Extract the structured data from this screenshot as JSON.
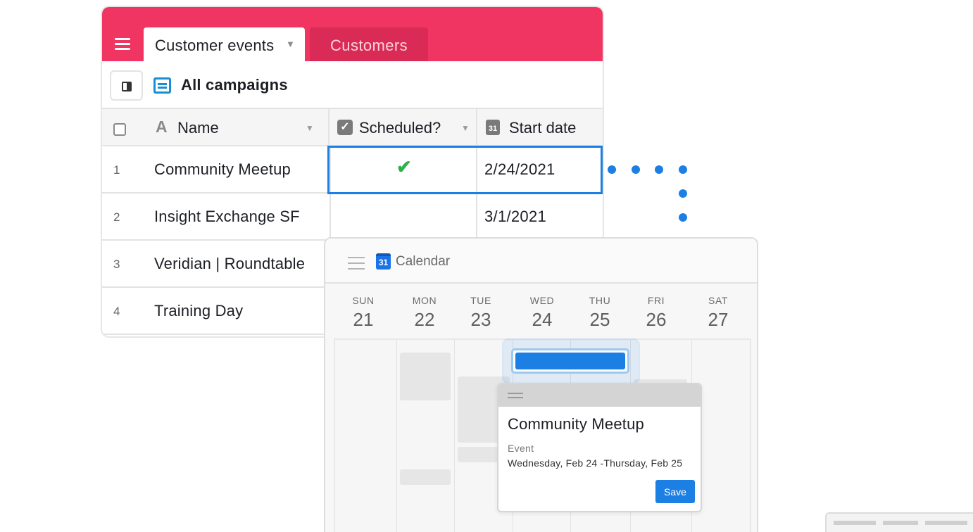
{
  "tabs": {
    "active": "Customer events",
    "inactive": "Customers"
  },
  "view": {
    "name": "All campaigns"
  },
  "columns": {
    "name": "Name",
    "scheduled": "Scheduled?",
    "start_date": "Start date",
    "start_date_icon": "31"
  },
  "rows": [
    {
      "num": "1",
      "name": "Community Meetup",
      "scheduled": true,
      "date": "2/24/2021"
    },
    {
      "num": "2",
      "name": "Insight Exchange SF",
      "scheduled": false,
      "date": "3/1/2021"
    },
    {
      "num": "3",
      "name": "Veridian | Roundtable",
      "scheduled": false,
      "date": ""
    },
    {
      "num": "4",
      "name": "Training Day",
      "scheduled": false,
      "date": ""
    }
  ],
  "calendar": {
    "title": "Calendar",
    "icon_number": "31",
    "days": [
      {
        "name": "SUN",
        "num": "21"
      },
      {
        "name": "MON",
        "num": "22"
      },
      {
        "name": "TUE",
        "num": "23"
      },
      {
        "name": "WED",
        "num": "24"
      },
      {
        "name": "THU",
        "num": "25"
      },
      {
        "name": "FRI",
        "num": "26"
      },
      {
        "name": "SAT",
        "num": "27"
      }
    ]
  },
  "popup": {
    "title": "Community Meetup",
    "type": "Event",
    "range": "Wednesday, Feb 24 -Thursday, Feb 25",
    "save_label": "Save"
  },
  "colors": {
    "brand_pink": "#f13562",
    "accent_blue": "#1b7fe3",
    "check_green": "#2bb34a"
  },
  "icons": {
    "menu": "menu-icon",
    "grid": "grid-view-icon",
    "checkbox": "checkbox-field-icon",
    "text": "text-field-icon",
    "date": "date-field-icon",
    "calendar": "google-calendar-icon",
    "check": "checkmark-icon"
  }
}
